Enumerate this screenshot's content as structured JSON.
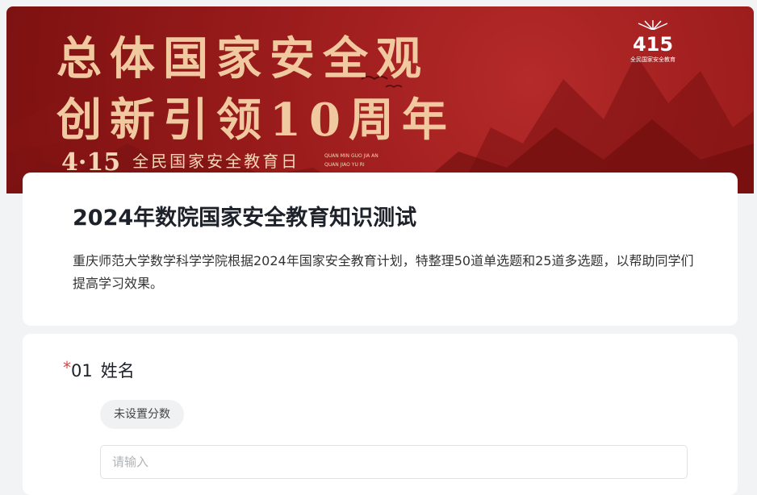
{
  "banner": {
    "headline_line1": "总体国家安全观",
    "headline_line2": "创新引领10周年",
    "date_number": "4·15",
    "date_text": "全民国家安全教育日",
    "pinyin": "QUAN MIN GUO JIA AN QUAN JIAO YU RI",
    "logo_number": "415",
    "logo_text": "全民国家安全教育"
  },
  "survey": {
    "title": "2024年数院国家安全教育知识测试",
    "description": "重庆师范大学数学科学学院根据2024年国家安全教育计划，特整理50道单选题和25道多选题，以帮助同学们提高学习效果。"
  },
  "question1": {
    "required_mark": "*",
    "number": "01",
    "label": "姓名",
    "score_tag": "未设置分数",
    "placeholder": "请输入",
    "value": ""
  }
}
